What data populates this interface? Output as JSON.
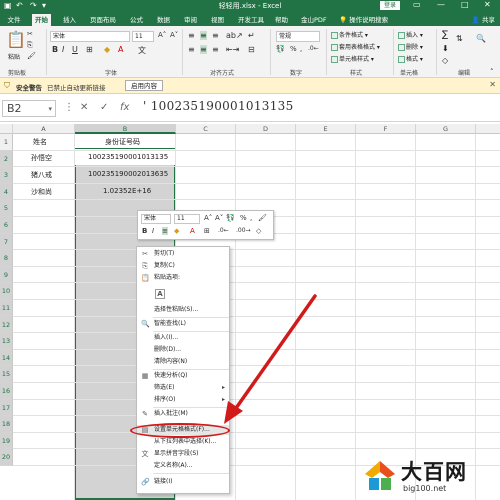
{
  "window": {
    "title": "轻轻用.xlsx - Excel",
    "login_label": "登录",
    "controls": [
      "—",
      "□",
      "✕"
    ]
  },
  "ribbon": {
    "tabs": [
      "文件",
      "开始",
      "插入",
      "页面布局",
      "公式",
      "数据",
      "审阅",
      "视图",
      "开发工具",
      "帮助",
      "金山PDF",
      "操作说明搜索"
    ],
    "active_tab": "开始",
    "share_label": "共享",
    "paste_label": "粘贴",
    "font_name": "宋体",
    "font_size": "11",
    "number_format": "常规",
    "groups": [
      "剪贴板",
      "字体",
      "对齐方式",
      "数字",
      "样式",
      "单元格",
      "编辑"
    ],
    "style_items": [
      "条件格式",
      "套用表格格式",
      "单元格样式"
    ],
    "cell_items": [
      "插入",
      "删除",
      "格式"
    ],
    "edit_items": [
      "∑",
      "排序和筛选",
      "查找和选择"
    ]
  },
  "security_bar": {
    "title": "安全警告",
    "message": "已禁止自动更新链接",
    "button": "启用内容",
    "close": "✕"
  },
  "formula_bar": {
    "name_box": "B2",
    "value": "' 100235190001013135"
  },
  "sheet": {
    "columns": [
      "A",
      "B",
      "C",
      "D",
      "E",
      "F",
      "G",
      "H"
    ],
    "rows": [
      "1",
      "2",
      "3",
      "4",
      "5",
      "6",
      "7",
      "8",
      "9",
      "10",
      "11",
      "12",
      "13",
      "14",
      "15",
      "16",
      "17",
      "18",
      "19",
      "20"
    ],
    "header_a": "姓名",
    "header_b": "身份证号码",
    "rows_data": [
      {
        "name": "孙悟空",
        "id": "100235190001013135"
      },
      {
        "name": "猪八戒",
        "id": "100235190002013635"
      },
      {
        "name": "沙和尚",
        "id": "1.02352E+16"
      }
    ]
  },
  "mini_toolbar": {
    "font_name": "宋体",
    "font_size": "11",
    "percent": "%",
    "comma": ","
  },
  "context_menu": {
    "items": [
      {
        "icon": "✂",
        "label": "剪切(T)"
      },
      {
        "icon": "⎘",
        "label": "复制(C)"
      },
      {
        "icon": "📋",
        "label": "粘贴选项:"
      },
      {
        "icon": "A",
        "label": ""
      },
      {
        "icon": "",
        "label": "选择性粘贴(S)..."
      },
      {
        "icon": "🔍",
        "label": "智能查找(L)"
      },
      {
        "icon": "",
        "label": "插入(I)..."
      },
      {
        "icon": "",
        "label": "删除(D)..."
      },
      {
        "icon": "",
        "label": "清除内容(N)"
      },
      {
        "icon": "▦",
        "label": "快速分析(Q)"
      },
      {
        "icon": "",
        "label": "筛选(E)"
      },
      {
        "icon": "",
        "label": "排序(O)"
      },
      {
        "icon": "✎",
        "label": "插入批注(M)"
      },
      {
        "icon": "▤",
        "label": "设置单元格格式(F)..."
      },
      {
        "icon": "",
        "label": "从下拉列表中选择(K)..."
      },
      {
        "icon": "文",
        "label": "显示拼音字段(S)"
      },
      {
        "icon": "",
        "label": "定义名称(A)..."
      },
      {
        "icon": "🔗",
        "label": "链接(I)"
      }
    ]
  },
  "watermark": {
    "brand": "大百网",
    "url": "big100.net"
  },
  "colors": {
    "excel_green": "#217346",
    "annotation_red": "#d11a1a"
  }
}
